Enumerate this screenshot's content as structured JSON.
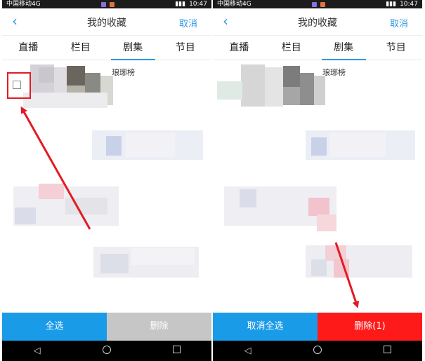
{
  "status_bar": {
    "carrier": "中国移动4G",
    "time": "10:47"
  },
  "colors": {
    "accent": "#2d9ae0",
    "select_button": "#1a9be8",
    "delete_disabled": "#c6c6c6",
    "delete_active": "#ff1a1a",
    "annotation": "#e31b23"
  },
  "screens": [
    {
      "title": "我的收藏",
      "cancel_label": "取消",
      "tabs": [
        "直播",
        "栏目",
        "剧集",
        "节目"
      ],
      "active_tab": "剧集",
      "item_name": "琅琊榜",
      "checkbox_checked": false,
      "buttons": {
        "select_all": "全选",
        "delete": "删除"
      }
    },
    {
      "title": "我的收藏",
      "cancel_label": "取消",
      "tabs": [
        "直播",
        "栏目",
        "剧集",
        "节目"
      ],
      "active_tab": "剧集",
      "item_name": "琅琊榜",
      "buttons": {
        "cancel_select_all": "取消全选",
        "delete": "删除(1)"
      }
    }
  ],
  "icons": {
    "back": "back-chevron-icon",
    "nav_back": "nav-back-triangle-icon",
    "nav_home": "nav-home-circle-icon",
    "nav_recent": "nav-recent-square-icon"
  }
}
